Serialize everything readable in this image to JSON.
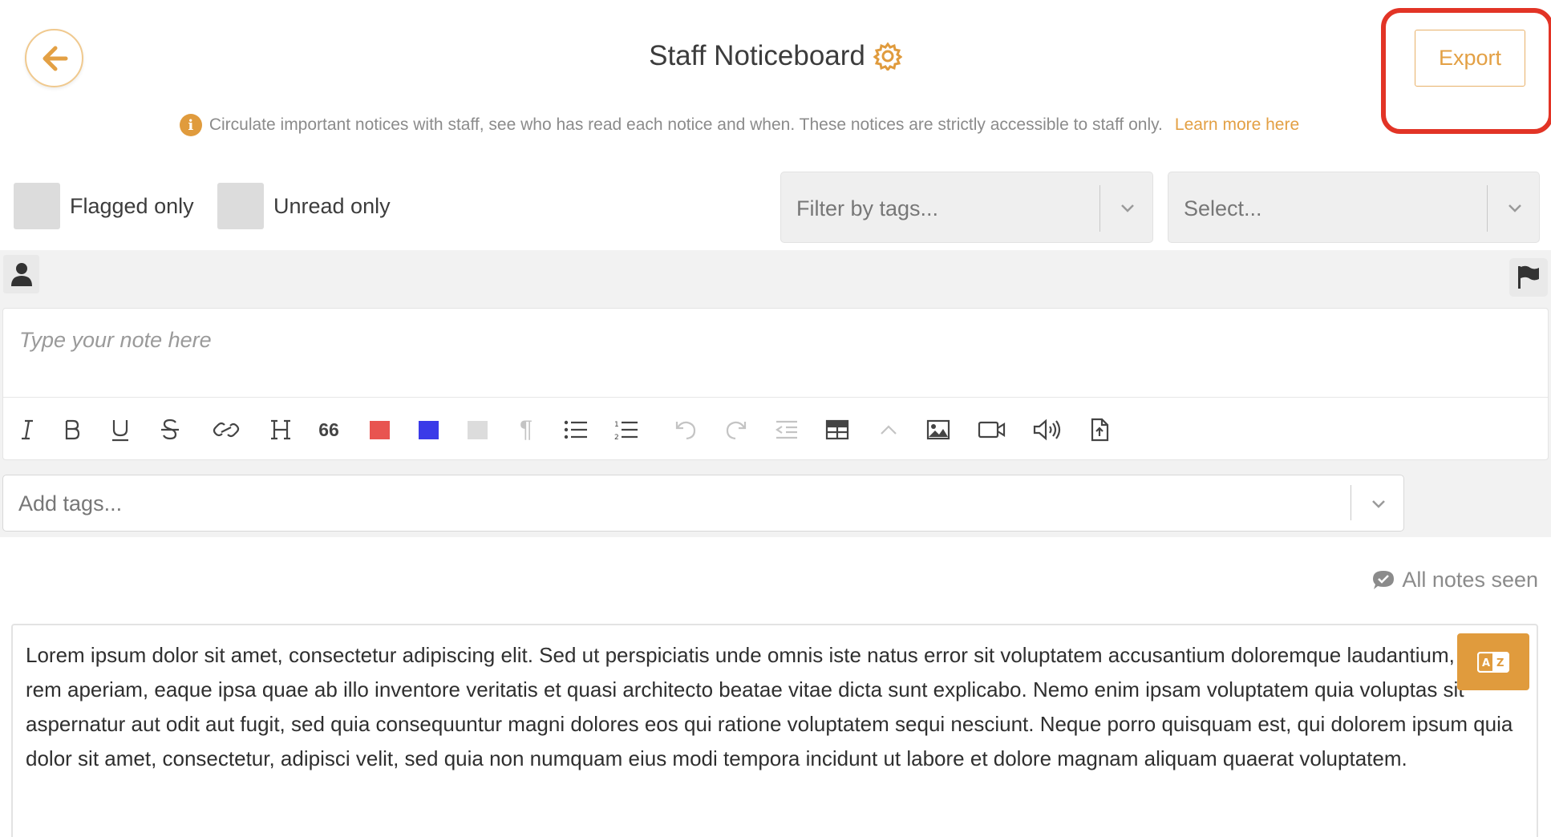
{
  "header": {
    "title": "Staff Noticeboard",
    "export_label": "Export"
  },
  "info": {
    "text": "Circulate important notices with staff, see who has read each notice and when. These notices are strictly accessible to staff only.",
    "link": "Learn more here"
  },
  "filters": {
    "flagged_label": "Flagged only",
    "unread_label": "Unread only",
    "tags_placeholder": "Filter by tags...",
    "select_placeholder": "Select..."
  },
  "composer": {
    "placeholder": "Type your note here",
    "tags_placeholder": "Add tags...",
    "toolbar": [
      {
        "icon": "italic-icon"
      },
      {
        "icon": "bold-icon"
      },
      {
        "icon": "underline-icon"
      },
      {
        "icon": "strikethrough-icon"
      },
      {
        "icon": "link-icon"
      },
      {
        "icon": "heading-icon"
      },
      {
        "icon": "quote-icon",
        "text": "66"
      },
      {
        "icon": "red-color-icon",
        "color": "#e85450"
      },
      {
        "icon": "blue-color-icon",
        "color": "#3a3ae8"
      },
      {
        "icon": "grey-color-icon",
        "color": "#dcdcdc"
      },
      {
        "icon": "paragraph-icon"
      },
      {
        "icon": "bullet-list-icon"
      },
      {
        "icon": "numbered-list-icon"
      },
      {
        "icon": "undo-icon"
      },
      {
        "icon": "redo-icon"
      },
      {
        "icon": "outdent-icon"
      },
      {
        "icon": "table-icon"
      },
      {
        "icon": "chevron-up-icon"
      },
      {
        "icon": "image-icon"
      },
      {
        "icon": "video-icon"
      },
      {
        "icon": "audio-icon"
      },
      {
        "icon": "file-upload-icon"
      }
    ]
  },
  "status": {
    "seen_label": "All notes seen"
  },
  "notes": [
    {
      "paragraph_1": "Lorem ipsum dolor sit amet, consectetur adipiscing elit. Sed ut perspiciatis unde omnis iste natus error sit voluptatem accusantium doloremque laudantium, totam rem aperiam, eaque ipsa quae ab illo inventore veritatis et quasi architecto beatae vitae dicta sunt explicabo. Nemo enim ipsam voluptatem quia voluptas sit aspernatur aut odit aut fugit, sed quia consequuntur magni dolores eos qui ratione voluptatem sequi nesciunt. Neque porro quisquam est, qui dolorem ipsum quia dolor sit amet, consectetur, adipisci velit, sed quia non numquam eius modi tempora incidunt ut labore et dolore magnam aliquam quaerat voluptatem."
    }
  ],
  "colors": {
    "accent": "#e09b3d",
    "highlight": "#e23426"
  }
}
